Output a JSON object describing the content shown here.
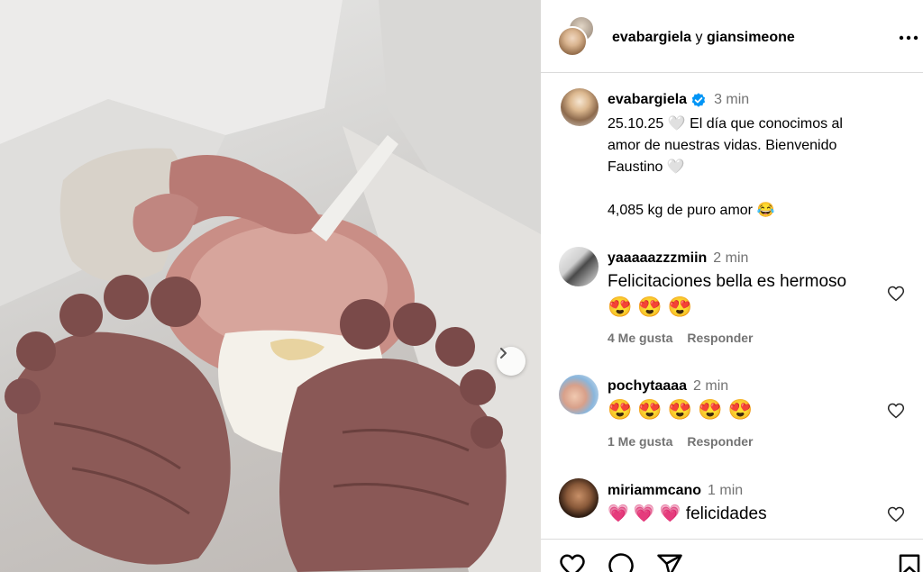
{
  "header": {
    "user1": "evabargiela",
    "joiner": "y",
    "user2": "giansimeone"
  },
  "caption": {
    "username": "evabargiela",
    "time": "3 min",
    "line1": "25.10.25",
    "line1_rest": "El día que conocimos al",
    "line2": "amor de nuestras vidas. Bienvenido",
    "line3": "Faustino",
    "line4": "4,085 kg de puro amor",
    "white_heart": "🤍",
    "laugh_emoji": "😂"
  },
  "comments": [
    {
      "username": "yaaaaazzzmiin",
      "time": "2 min",
      "text": "Felicitaciones bella es hermoso",
      "emoji": "😍",
      "emoji_count": 3,
      "likes": "4 Me gusta",
      "reply": "Responder"
    },
    {
      "username": "pochytaaaa",
      "time": "2 min",
      "emoji": "😍",
      "emoji_count": 5,
      "likes": "1 Me gusta",
      "reply": "Responder"
    },
    {
      "username": "miriammcano",
      "time": "1 min",
      "hearts": "💗 💗 💗",
      "text": "felicidades"
    }
  ],
  "icons": {
    "more": "more-options-icon",
    "verified": "verified-badge-icon",
    "next": "chevron-right-icon",
    "like": "heart-icon",
    "comment": "comment-icon",
    "share": "share-icon",
    "save": "bookmark-icon"
  },
  "colors": {
    "verified": "#0095f6",
    "muted": "#737373",
    "divider": "#dbdbdb"
  }
}
